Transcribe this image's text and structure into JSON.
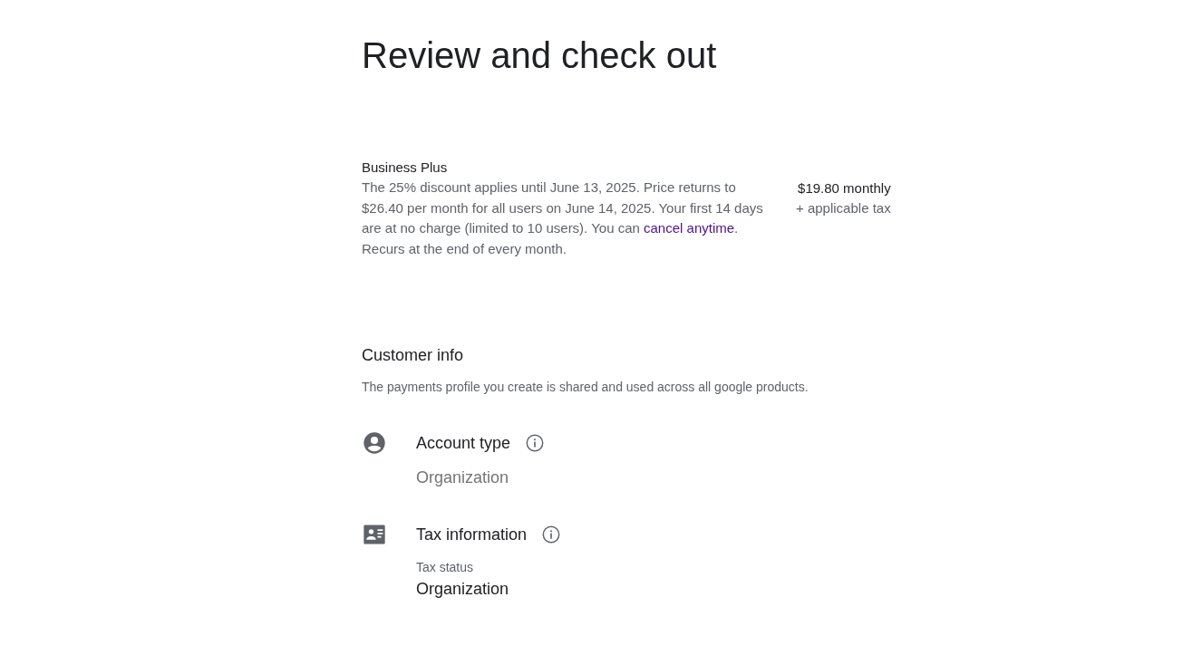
{
  "title": "Review and check out",
  "plan": {
    "name": "Business Plus",
    "description_before": "The 25% discount applies until June 13, 2025. Price returns to $26.40 per month for all users on June 14, 2025. Your first 14 days are at no charge (limited to 10 users). You can",
    "link": "cancel anytime",
    "description_after": ".",
    "recurrence": "Recurs at the end of every month.",
    "price": "$19.80 monthly",
    "tax_note": "+ applicable tax"
  },
  "customer_info": {
    "heading": "Customer info",
    "note": "The payments profile you create is shared and used across all google products.",
    "sections": [
      {
        "kind": "account",
        "label": "Account type",
        "value": "Organization"
      },
      {
        "kind": "tax",
        "label": "Tax information",
        "sublabel": "Tax status",
        "value": "Organization"
      }
    ]
  }
}
